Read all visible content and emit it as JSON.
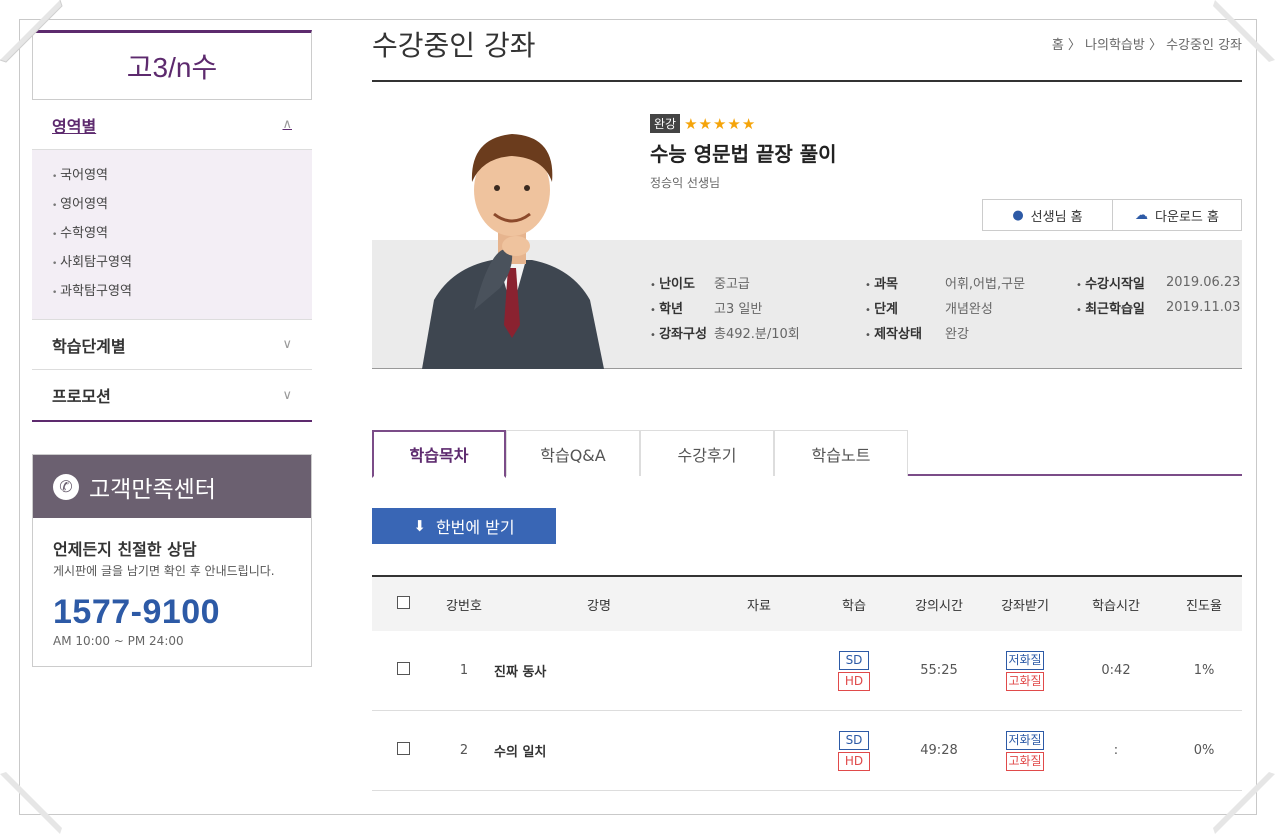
{
  "sidebar": {
    "title": "고3/n수",
    "menus": [
      {
        "label": "영역별",
        "expanded": true
      },
      {
        "label": "학습단계별",
        "expanded": false
      },
      {
        "label": "프로모션",
        "expanded": false
      }
    ],
    "sub_items": [
      "국어영역",
      "영어영역",
      "수학영역",
      "사회탐구영역",
      "과학탐구영역"
    ],
    "chev_up": "∧",
    "chev_down": "∨"
  },
  "cs": {
    "title": "고객만족센터",
    "line1": "언제든지 친절한 상담",
    "line2": "게시판에 글을 남기면 확인 후 안내드립니다.",
    "phone": "1577-9100",
    "hours": "AM 10:00 ~ PM 24:00"
  },
  "page": {
    "title": "수강중인 강좌",
    "breadcrumb": "홈 〉 나의학습방 〉 수강중인 강좌"
  },
  "course": {
    "badge": "완강",
    "stars": "★★★★★",
    "title": "수능 영문법 끝장 풀이",
    "teacher": "정승익 선생님",
    "btn_teacher_home": "선생님 홈",
    "btn_download_home": "다운로드 홈",
    "meta": {
      "col1": [
        {
          "k": "난이도",
          "v": "중고급"
        },
        {
          "k": "학년",
          "v": "고3 일반"
        },
        {
          "k": "강좌구성",
          "v": "총492.분/10회"
        }
      ],
      "col2": [
        {
          "k": "과목",
          "v": "어휘,어법,구문"
        },
        {
          "k": "단계",
          "v": "개념완성"
        },
        {
          "k": "제작상태",
          "v": "완강"
        }
      ],
      "col3": [
        {
          "k": "수강시작일",
          "v": "2019.06.23"
        },
        {
          "k": "최근학습일",
          "v": "2019.11.03"
        }
      ]
    }
  },
  "tabs": [
    "학습목차",
    "학습Q&A",
    "수강후기",
    "학습노트"
  ],
  "download_all": "한번에 받기",
  "table": {
    "headers": [
      "강번호",
      "강명",
      "자료",
      "학습",
      "강의시간",
      "강좌받기",
      "학습시간",
      "진도율"
    ],
    "rows": [
      {
        "no": "1",
        "name": "진짜 동사",
        "sd": "SD",
        "hd": "HD",
        "time": "55:25",
        "low": "저화질",
        "high": "고화질",
        "study": "0:42",
        "progress": "1%"
      },
      {
        "no": "2",
        "name": "수의 일치",
        "sd": "SD",
        "hd": "HD",
        "time": "49:28",
        "low": "저화질",
        "high": "고화질",
        "study": ":",
        "progress": "0%"
      }
    ]
  }
}
